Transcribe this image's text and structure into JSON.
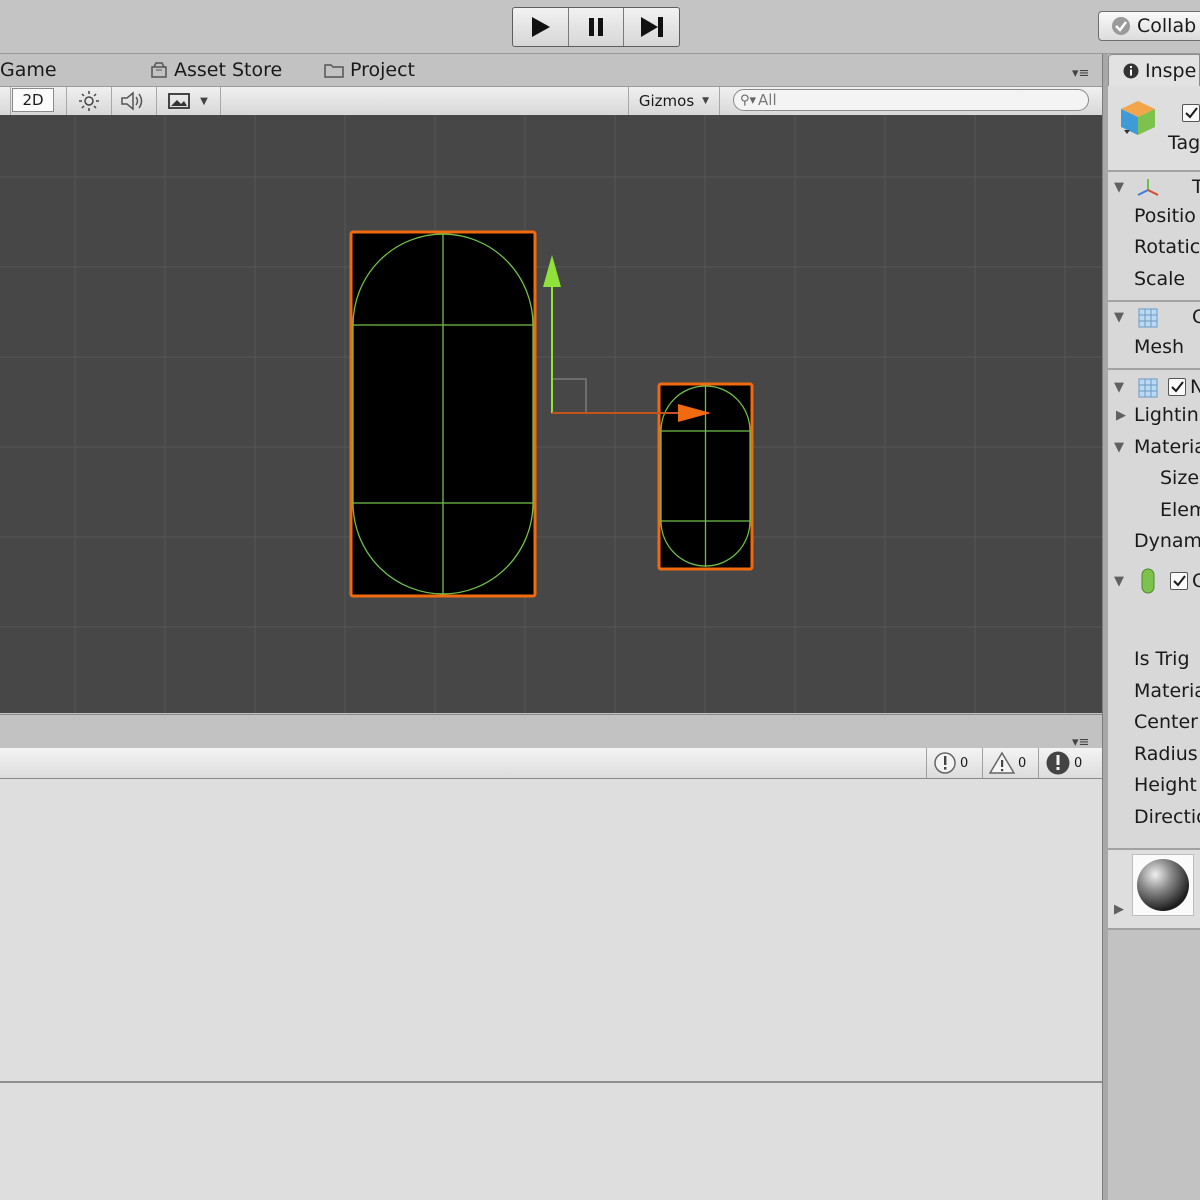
{
  "toolbar": {
    "play_icon": "play-icon",
    "pause_icon": "pause-icon",
    "step_icon": "step-icon",
    "collab_label": "Collab"
  },
  "tabs": {
    "game": "Game",
    "asset_store": "Asset Store",
    "project": "Project"
  },
  "scene_toolbar": {
    "mode_2d": "2D",
    "gizmos": "Gizmos",
    "search_placeholder": "All"
  },
  "console": {
    "info_count": "0",
    "warning_count": "0",
    "error_count": "0"
  },
  "inspector": {
    "tab_label": "Inspe",
    "tag_label": "Tag",
    "transform_header": "T",
    "position": "Positio",
    "rotation": "Rotatic",
    "scale": "Scale",
    "mesh_filter_header": "C",
    "mesh": "Mesh",
    "mesh_renderer_header": "N",
    "lighting": "Lightin",
    "materials": "Materia",
    "size": "Size",
    "element": "Elem",
    "dynamic": "Dynam",
    "collider_header": "C",
    "is_trigger": "Is Trig",
    "material": "Materia",
    "center": "Center",
    "radius": "Radius",
    "height": "Height",
    "direction": "Directio"
  },
  "colors": {
    "scene_bg": "#474747",
    "selection_outline": "#f26a0f",
    "collider_wire": "#6fbf4a",
    "gizmo_y": "#8ee23a",
    "gizmo_x": "#f26a0f"
  }
}
